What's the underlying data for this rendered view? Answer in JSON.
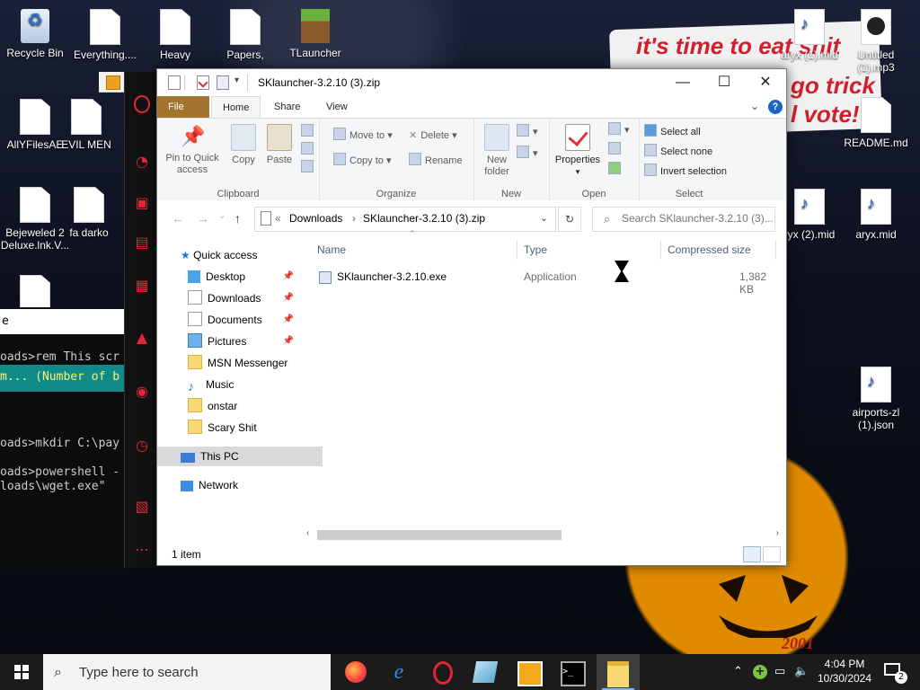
{
  "wallpaper": {
    "banner_lines": [
      "it's time to eat shit",
      "go trick",
      "l vote!"
    ],
    "pumpkin_text": "2001"
  },
  "desktop_icons": [
    {
      "label": "Recycle Bin",
      "type": "recycle"
    },
    {
      "label": "Everything....",
      "type": "file"
    },
    {
      "label": "Heavy",
      "type": "file"
    },
    {
      "label": "Papers,",
      "type": "file"
    },
    {
      "label": "TLauncher",
      "type": "minecraft"
    },
    {
      "label": "AllYFilesAE",
      "type": "file"
    },
    {
      "label": "EVIL MEN",
      "type": "file"
    },
    {
      "label": "Bejeweled 2 Deluxe.lnk.V...",
      "type": "file"
    },
    {
      "label": "fa darko",
      "type": "file"
    },
    {
      "label": "aryx (1).mid",
      "type": "audio"
    },
    {
      "label": "Untitled (1).mp3",
      "type": "mp3"
    },
    {
      "label": "README.md",
      "type": "file"
    },
    {
      "label": "ryx (2).mid",
      "type": "audio"
    },
    {
      "label": "aryx.mid",
      "type": "audio"
    },
    {
      "label": "airports-zl (1).json",
      "type": "audio"
    }
  ],
  "console": {
    "header": "e",
    "lines": [
      "oads>rem This scr",
      "m... (Number of b",
      "oads>mkdir C:\\pay",
      "oads>powershell -",
      "loads\\wget.exe\""
    ]
  },
  "explorer": {
    "title": "SKlauncher-3.2.10 (3).zip",
    "window_buttons": {
      "minimize": "—",
      "maximize": "☐",
      "close": "✕"
    },
    "tabs": [
      {
        "label": "File"
      },
      {
        "label": "Home"
      },
      {
        "label": "Share"
      },
      {
        "label": "View"
      }
    ],
    "help": "?",
    "ribbon": {
      "clipboard": {
        "label": "Clipboard",
        "pin": "Pin to Quick access",
        "copy": "Copy",
        "paste": "Paste"
      },
      "organize": {
        "label": "Organize",
        "move_to": "Move to",
        "copy_to": "Copy to",
        "delete": "Delete",
        "rename": "Rename"
      },
      "new": {
        "label": "New",
        "new_folder": "New folder"
      },
      "open": {
        "label": "Open",
        "properties": "Properties"
      },
      "select": {
        "label": "Select",
        "select_all": "Select all",
        "select_none": "Select none",
        "invert": "Invert selection"
      }
    },
    "address": {
      "prefix": "«",
      "crumbs": [
        "Downloads",
        "SKlauncher-3.2.10 (3).zip"
      ],
      "sep": "›"
    },
    "search_placeholder": "Search SKlauncher-3.2.10 (3)...",
    "nav": {
      "quick_access": "Quick access",
      "pinned": [
        {
          "label": "Desktop",
          "icon": "folder-blue",
          "pinned": true
        },
        {
          "label": "Downloads",
          "icon": "folder-doc",
          "pinned": true
        },
        {
          "label": "Documents",
          "icon": "folder-doc",
          "pinned": true
        },
        {
          "label": "Pictures",
          "icon": "folder-pic",
          "pinned": true
        },
        {
          "label": "MSN Messenger",
          "icon": "folder"
        },
        {
          "label": "Music",
          "icon": "music"
        },
        {
          "label": "onstar",
          "icon": "folder"
        },
        {
          "label": "Scary Shit",
          "icon": "folder"
        }
      ],
      "this_pc": "This PC",
      "network": "Network"
    },
    "columns": [
      "Name",
      "Type",
      "Compressed size"
    ],
    "files": [
      {
        "name": "SKlauncher-3.2.10.exe",
        "type": "Application",
        "size": "1,382 KB"
      }
    ],
    "status": "1 item"
  },
  "taskbar": {
    "search_placeholder": "Type here to search",
    "apps": [
      "firefox-icon",
      "edge-icon",
      "opera-icon",
      "app-icon",
      "vlc-icon",
      "terminal-icon",
      "file-explorer-icon"
    ],
    "time": "4:04 PM",
    "date": "10/30/2024",
    "notifications": "2"
  }
}
